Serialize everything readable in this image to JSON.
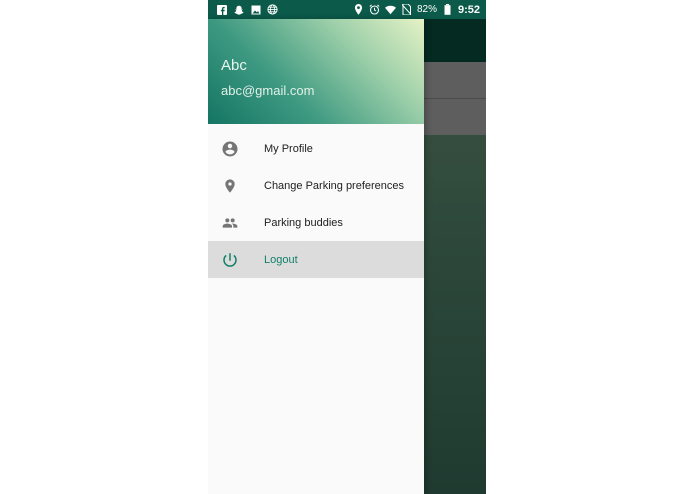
{
  "status_bar": {
    "left_icons": [
      "facebook-icon",
      "snapchat-icon",
      "image-icon",
      "globe-icon"
    ],
    "right_icons": [
      "location-icon",
      "alarm-icon",
      "wifi-icon",
      "no-sim-icon",
      "battery-icon"
    ],
    "battery": "82%",
    "time": "9:52"
  },
  "drawer": {
    "user_name": "Abc",
    "user_email": "abc@gmail.com",
    "items": [
      {
        "label": "My Profile",
        "icon": "account-circle-icon",
        "active": false
      },
      {
        "label": "Change Parking preferences",
        "icon": "location-pin-icon",
        "active": false
      },
      {
        "label": "Parking buddies",
        "icon": "people-icon",
        "active": false
      },
      {
        "label": "Logout",
        "icon": "power-icon",
        "active": true
      }
    ]
  },
  "colors": {
    "status_bar": "#0b5a4a",
    "accent": "#13806a",
    "icon_gray": "#757575",
    "active_row": "#dcdcdc"
  }
}
